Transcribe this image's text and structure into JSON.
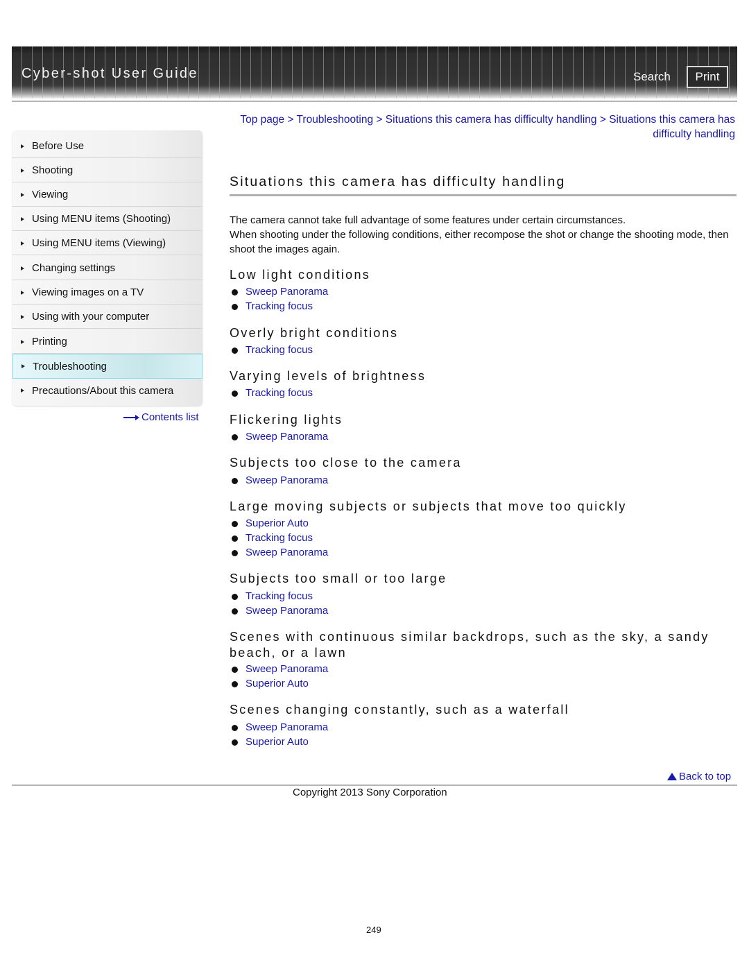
{
  "header": {
    "title": "Cyber-shot User Guide",
    "search_label": "Search",
    "print_label": "Print"
  },
  "sidebar": {
    "items": [
      {
        "label": "Before Use",
        "active": false
      },
      {
        "label": "Shooting",
        "active": false
      },
      {
        "label": "Viewing",
        "active": false
      },
      {
        "label": "Using MENU items (Shooting)",
        "active": false
      },
      {
        "label": "Using MENU items (Viewing)",
        "active": false
      },
      {
        "label": "Changing settings",
        "active": false
      },
      {
        "label": "Viewing images on a TV",
        "active": false
      },
      {
        "label": "Using with your computer",
        "active": false
      },
      {
        "label": "Printing",
        "active": false
      },
      {
        "label": "Troubleshooting",
        "active": true
      },
      {
        "label": "Precautions/About this camera",
        "active": false
      }
    ],
    "contents_list_label": "Contents list"
  },
  "breadcrumb": {
    "items": [
      "Top page",
      "Troubleshooting",
      "Situations this camera has difficulty handling",
      "Situations this camera has difficulty handling"
    ],
    "separator": ">"
  },
  "main": {
    "title": "Situations this camera has difficulty handling",
    "intro_line1": "The camera cannot take full advantage of some features under certain circumstances.",
    "intro_line2": "When shooting under the following conditions, either recompose the shot or change the shooting mode, then shoot the images again.",
    "sections": [
      {
        "heading": "Low light conditions",
        "links": [
          "Sweep Panorama",
          "Tracking focus"
        ]
      },
      {
        "heading": "Overly bright conditions",
        "links": [
          "Tracking focus"
        ]
      },
      {
        "heading": "Varying levels of brightness",
        "links": [
          "Tracking focus"
        ]
      },
      {
        "heading": "Flickering lights",
        "links": [
          "Sweep Panorama"
        ]
      },
      {
        "heading": "Subjects too close to the camera",
        "links": [
          "Sweep Panorama"
        ]
      },
      {
        "heading": "Large moving subjects or subjects that move too quickly",
        "links": [
          "Superior Auto",
          "Tracking focus",
          "Sweep Panorama"
        ]
      },
      {
        "heading": "Subjects too small or too large",
        "links": [
          "Tracking focus",
          "Sweep Panorama"
        ]
      },
      {
        "heading": "Scenes with continuous similar backdrops, such as the sky, a sandy beach, or a lawn",
        "links": [
          "Sweep Panorama",
          "Superior Auto"
        ]
      },
      {
        "heading": "Scenes changing constantly, such as a waterfall",
        "links": [
          "Sweep Panorama",
          "Superior Auto"
        ]
      }
    ]
  },
  "footer": {
    "back_to_top_label": "Back to top",
    "copyright": "Copyright 2013 Sony Corporation",
    "page_number": "249"
  },
  "colors": {
    "link": "#1a1aa8",
    "active_nav_border": "#86dceb",
    "header_bg": "#333333"
  }
}
